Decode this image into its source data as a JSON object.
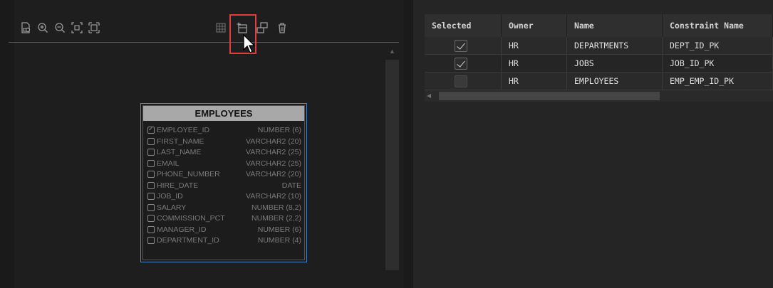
{
  "toolbar": {
    "icons": [
      "save-image-icon",
      "zoom-in-icon",
      "zoom-out-icon",
      "fit-icon",
      "actual-size-icon",
      "table-icon",
      "add-constraint-icon",
      "layout-icon",
      "delete-icon"
    ],
    "highlight_color": "#e03c3c"
  },
  "entity": {
    "title": "EMPLOYEES",
    "columns": [
      {
        "name": "EMPLOYEE_ID",
        "type": "NUMBER (6)",
        "checked": true
      },
      {
        "name": "FIRST_NAME",
        "type": "VARCHAR2 (20)",
        "checked": false
      },
      {
        "name": "LAST_NAME",
        "type": "VARCHAR2 (25)",
        "checked": false
      },
      {
        "name": "EMAIL",
        "type": "VARCHAR2 (25)",
        "checked": false
      },
      {
        "name": "PHONE_NUMBER",
        "type": "VARCHAR2 (20)",
        "checked": false
      },
      {
        "name": "HIRE_DATE",
        "type": "DATE",
        "checked": false
      },
      {
        "name": "JOB_ID",
        "type": "VARCHAR2 (10)",
        "checked": false
      },
      {
        "name": "SALARY",
        "type": "NUMBER (8,2)",
        "checked": false
      },
      {
        "name": "COMMISSION_PCT",
        "type": "NUMBER (2,2)",
        "checked": false
      },
      {
        "name": "MANAGER_ID",
        "type": "NUMBER (6)",
        "checked": false
      },
      {
        "name": "DEPARTMENT_ID",
        "type": "NUMBER (4)",
        "checked": false
      }
    ]
  },
  "constraints_table": {
    "headers": [
      "Selected",
      "Owner",
      "Name",
      "Constraint Name"
    ],
    "rows": [
      {
        "selected": true,
        "owner": "HR",
        "name": "DEPARTMENTS",
        "constraint": "DEPT_ID_PK"
      },
      {
        "selected": true,
        "owner": "HR",
        "name": "JOBS",
        "constraint": "JOB_ID_PK"
      },
      {
        "selected": false,
        "owner": "HR",
        "name": "EMPLOYEES",
        "constraint": "EMP_EMP_ID_PK"
      }
    ]
  }
}
